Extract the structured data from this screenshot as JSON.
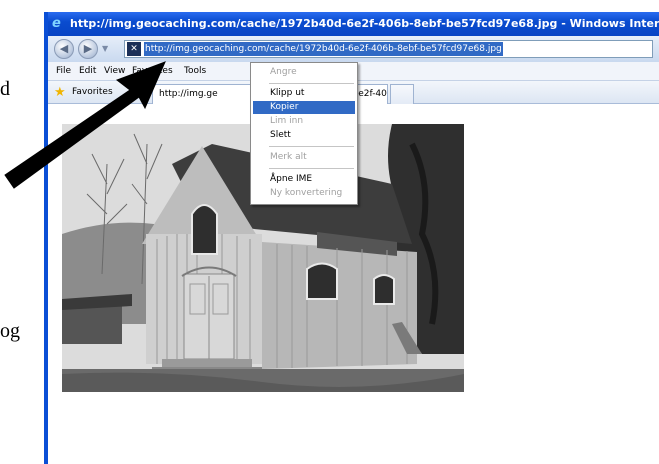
{
  "document": {
    "fragment_top": "d",
    "fragment_bottom": "og"
  },
  "window": {
    "title": "http://img.geocaching.com/cache/1972b40d-6e2f-406b-8ebf-be57fcd97e68.jpg - Windows Internet Explorer",
    "address_url": "http://img.geocaching.com/cache/1972b40d-6e2f-406b-8ebf-be57fcd97e68.jpg",
    "title_icon": "ie-logo-icon",
    "site_icon": "geocaching-icon"
  },
  "menubar": {
    "items": [
      "File",
      "Edit",
      "View",
      "Favorites",
      "Tools"
    ]
  },
  "favorites_bar": {
    "label": "Favorites",
    "tab_url_fragment": "http://img.ge",
    "tab_suffix": "2b40d-6e2f-40..."
  },
  "context_menu": {
    "items": [
      {
        "label": "Angre",
        "enabled": false,
        "selected": false
      },
      {
        "label": "Klipp ut",
        "enabled": true,
        "selected": false
      },
      {
        "label": "Kopier",
        "enabled": true,
        "selected": true
      },
      {
        "label": "Lim inn",
        "enabled": false,
        "selected": false
      },
      {
        "label": "Slett",
        "enabled": true,
        "selected": false
      },
      {
        "label": "Merk alt",
        "enabled": false,
        "selected": false
      },
      {
        "label": "Åpne IME",
        "enabled": true,
        "selected": false
      },
      {
        "label": "Ny konvertering",
        "enabled": false,
        "selected": false
      }
    ]
  },
  "colors": {
    "titlebar": "#0a4ccf",
    "selection": "#316ac5",
    "arrow": "#000000"
  }
}
